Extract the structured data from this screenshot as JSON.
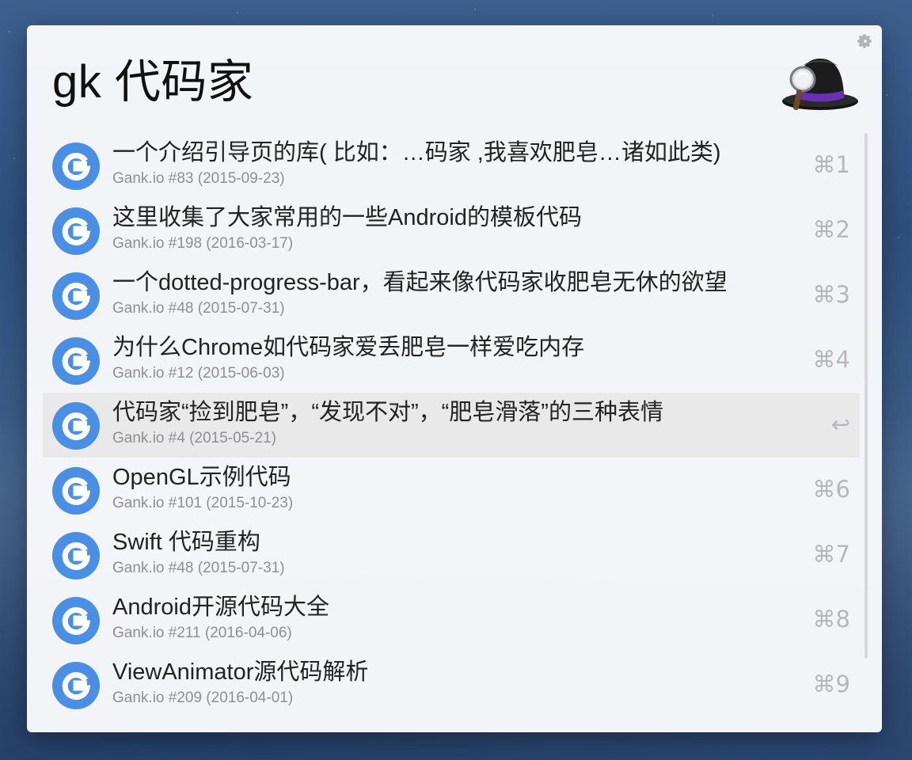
{
  "search": {
    "query": "gk 代码家"
  },
  "icons": {
    "result_icon": "google-g-icon",
    "settings": "gear-icon",
    "app_logo": "alfred-hat-logo"
  },
  "colors": {
    "result_icon_blue": "#4a8fe3",
    "selected_row": "#e9e9ea",
    "subtitle": "#8e8e93",
    "shortcut": "#b6b6bb"
  },
  "results": [
    {
      "title": "一个介绍引导页的库( 比如：…码家 ,我喜欢肥皂…诸如此类)",
      "subtitle": "Gank.io #83 (2015-09-23)",
      "shortcut": "⌘1",
      "selected": false
    },
    {
      "title": "这里收集了大家常用的一些Android的模板代码",
      "subtitle": "Gank.io #198 (2016-03-17)",
      "shortcut": "⌘2",
      "selected": false
    },
    {
      "title": "一个dotted-progress-bar，看起来像代码家收肥皂无休的欲望",
      "subtitle": "Gank.io #48 (2015-07-31)",
      "shortcut": "⌘3",
      "selected": false
    },
    {
      "title": "为什么Chrome如代码家爱丢肥皂一样爱吃内存",
      "subtitle": "Gank.io #12 (2015-06-03)",
      "shortcut": "⌘4",
      "selected": false
    },
    {
      "title": "代码家“捡到肥皂”，“发现不对”，“肥皂滑落”的三种表情",
      "subtitle": "Gank.io #4 (2015-05-21)",
      "shortcut": "↩",
      "selected": true
    },
    {
      "title": "OpenGL示例代码",
      "subtitle": "Gank.io #101 (2015-10-23)",
      "shortcut": "⌘6",
      "selected": false
    },
    {
      "title": "Swift 代码重构",
      "subtitle": "Gank.io #48 (2015-07-31)",
      "shortcut": "⌘7",
      "selected": false
    },
    {
      "title": "Android开源代码大全",
      "subtitle": "Gank.io #211 (2016-04-06)",
      "shortcut": "⌘8",
      "selected": false
    },
    {
      "title": "ViewAnimator源代码解析",
      "subtitle": "Gank.io #209 (2016-04-01)",
      "shortcut": "⌘9",
      "selected": false
    }
  ]
}
